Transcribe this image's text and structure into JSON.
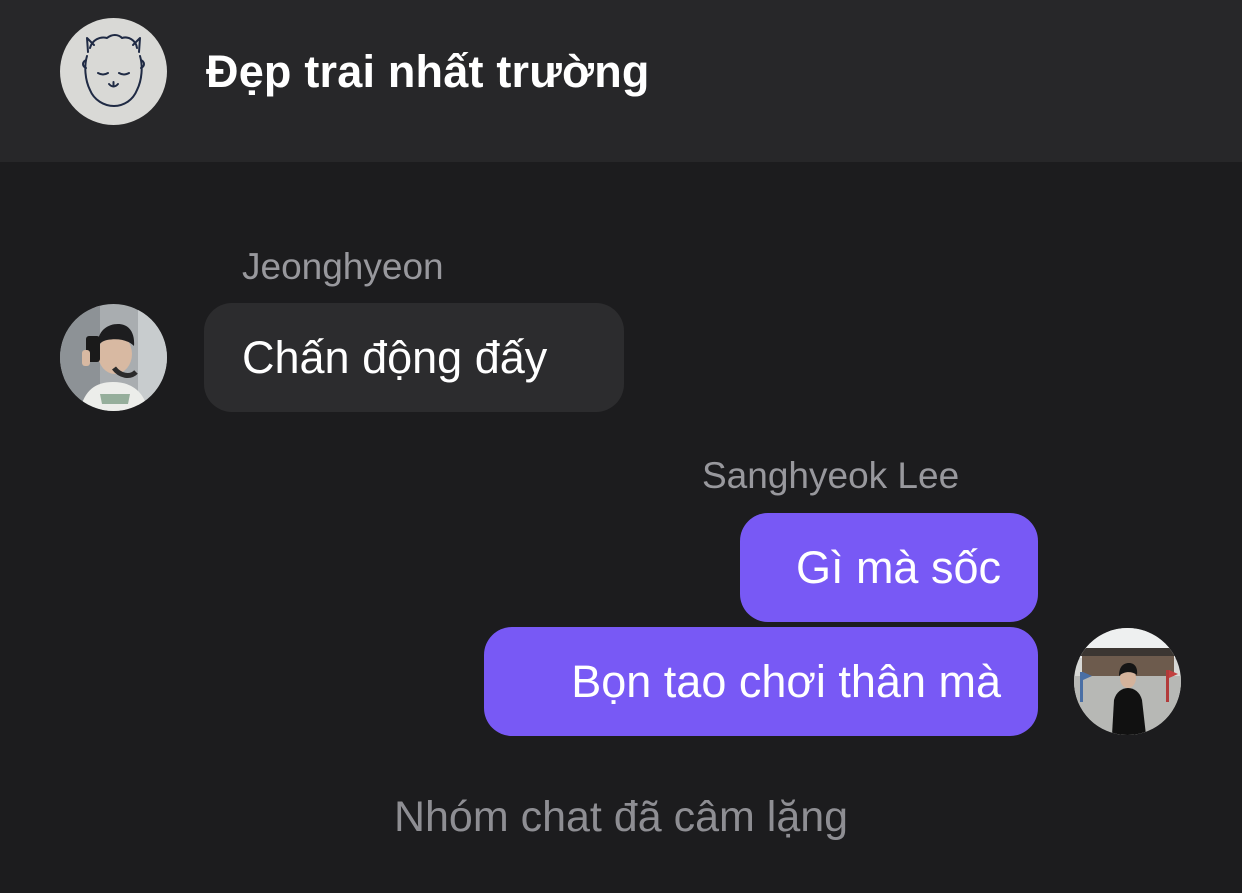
{
  "conversation": {
    "title": "Đẹp trai nhất trường",
    "group_avatar_icon": "alpaca-icon"
  },
  "messages": [
    {
      "sender": "Jeonghyeon",
      "direction": "incoming",
      "avatar_icon": "profile-photo-icon",
      "texts": [
        "Chấn động đấy"
      ]
    },
    {
      "sender": "Sanghyeok Lee",
      "direction": "outgoing",
      "avatar_icon": "profile-photo-icon",
      "texts": [
        "Gì mà sốc",
        "Bọn tao chơi thân mà"
      ]
    }
  ],
  "status": {
    "muted_note": "Nhóm chat đã câm lặng"
  },
  "colors": {
    "background": "#1c1c1e",
    "header": "#272729",
    "incoming_bubble": "#2c2c2e",
    "outgoing_bubble": "#7859f5",
    "secondary_text": "#98989d"
  }
}
